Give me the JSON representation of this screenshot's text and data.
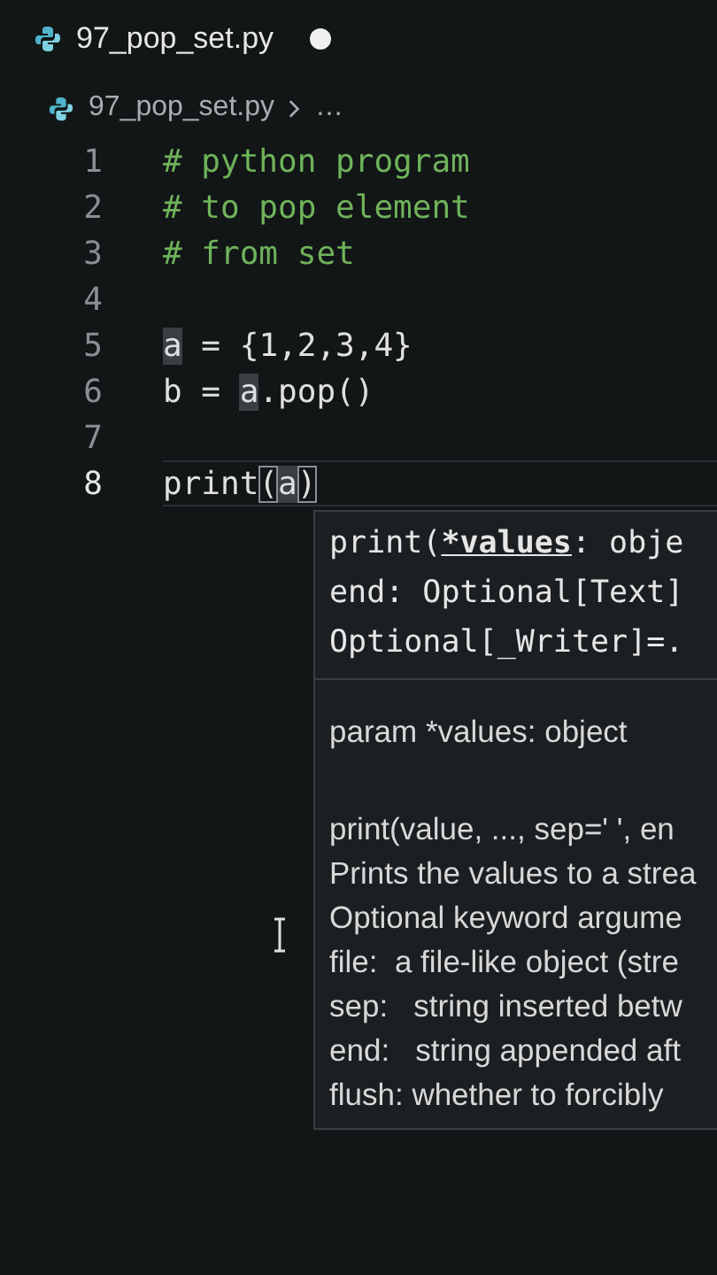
{
  "tab": {
    "title": "97_pop_set.py",
    "modified": true
  },
  "breadcrumb": {
    "file": "97_pop_set.py",
    "rest": "…"
  },
  "lines": [
    {
      "number": "1",
      "current": false,
      "tokens": [
        {
          "kind": "comment",
          "text": "# python program"
        }
      ]
    },
    {
      "number": "2",
      "current": false,
      "tokens": [
        {
          "kind": "comment",
          "text": "# to pop element"
        }
      ]
    },
    {
      "number": "3",
      "current": false,
      "tokens": [
        {
          "kind": "comment",
          "text": "# from set"
        }
      ]
    },
    {
      "number": "4",
      "current": false
    },
    {
      "number": "5",
      "current": false,
      "tokens": [
        {
          "kind": "highlight",
          "text": "a"
        },
        {
          "kind": "plain",
          "text": " = {1,2,3,4}"
        }
      ]
    },
    {
      "number": "6",
      "current": false,
      "tokens": [
        {
          "kind": "plain",
          "text": "b = "
        },
        {
          "kind": "highlight",
          "text": "a"
        },
        {
          "kind": "plain",
          "text": ".pop()"
        }
      ]
    },
    {
      "number": "7",
      "current": false
    },
    {
      "number": "8",
      "current": true,
      "tokens": [
        {
          "kind": "plain",
          "text": "print"
        },
        {
          "kind": "bracket",
          "text": "("
        },
        {
          "kind": "highlight",
          "text": "a"
        },
        {
          "kind": "bracket",
          "text": ")"
        }
      ]
    }
  ],
  "signature_help": {
    "signature": [
      "print(***values**: obje",
      "end: Optional[Text]",
      "Optional[_Writer]=."
    ],
    "param": "param *values: object",
    "doc": [
      "print(value, ..., sep=' ', en",
      "Prints the values to a strea",
      "Optional keyword argume",
      "file:  a file-like object (stre",
      "sep:   string inserted betw",
      "end:   string appended aft",
      "flush: whether to forcibly"
    ]
  }
}
